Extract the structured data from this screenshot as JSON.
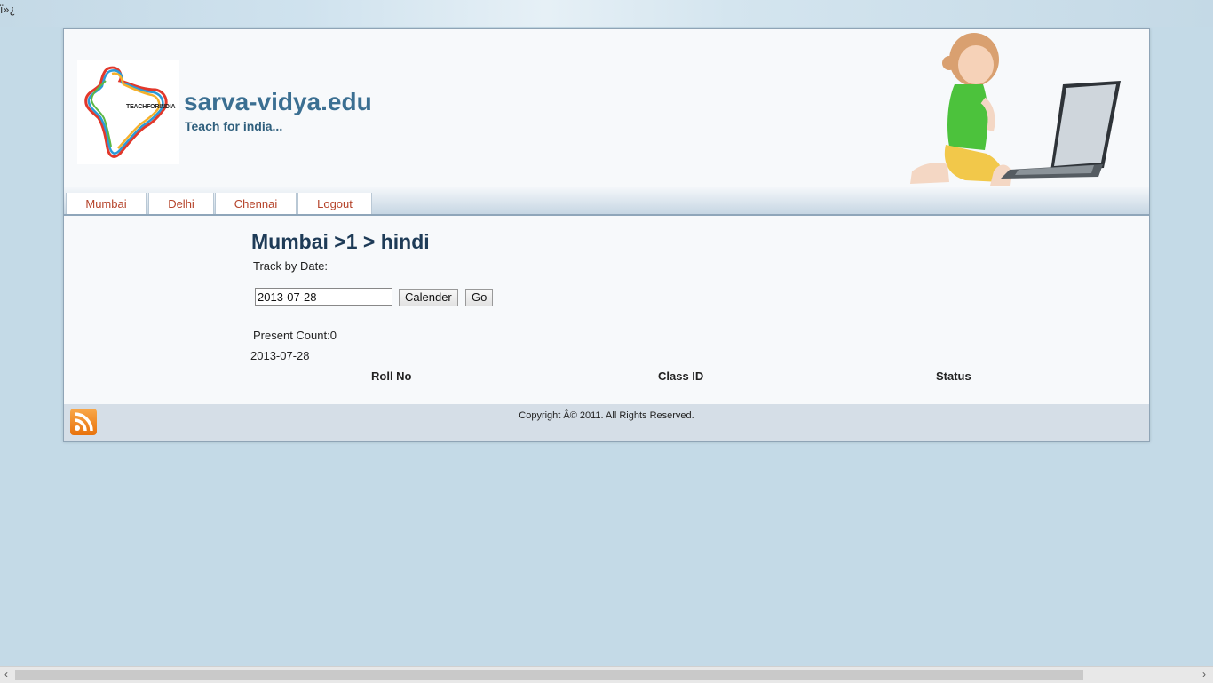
{
  "bom_text": "ï»¿",
  "header": {
    "site_title": "sarva-vidya.edu",
    "tagline": "Teach for india...",
    "logo_text": "TEACHFORINDIA"
  },
  "nav": {
    "tabs": [
      {
        "label": "Mumbai"
      },
      {
        "label": "Delhi"
      },
      {
        "label": "Chennai"
      },
      {
        "label": "Logout"
      }
    ]
  },
  "main": {
    "breadcrumb": "Mumbai >1 > hindi",
    "track_label": "Track by Date:",
    "date_value": "2013-07-28",
    "calendar_button": "Calender",
    "go_button": "Go",
    "present_count": "Present Count:0",
    "selected_date": "2013-07-28",
    "columns": [
      "Roll No",
      "Class ID",
      "Status"
    ]
  },
  "footer": {
    "copyright": "Copyright Â© 2011. All Rights Reserved."
  },
  "colors": {
    "accent": "#3b6f92",
    "tab_text": "#b5432a",
    "page_bg": "#c4dae7"
  }
}
